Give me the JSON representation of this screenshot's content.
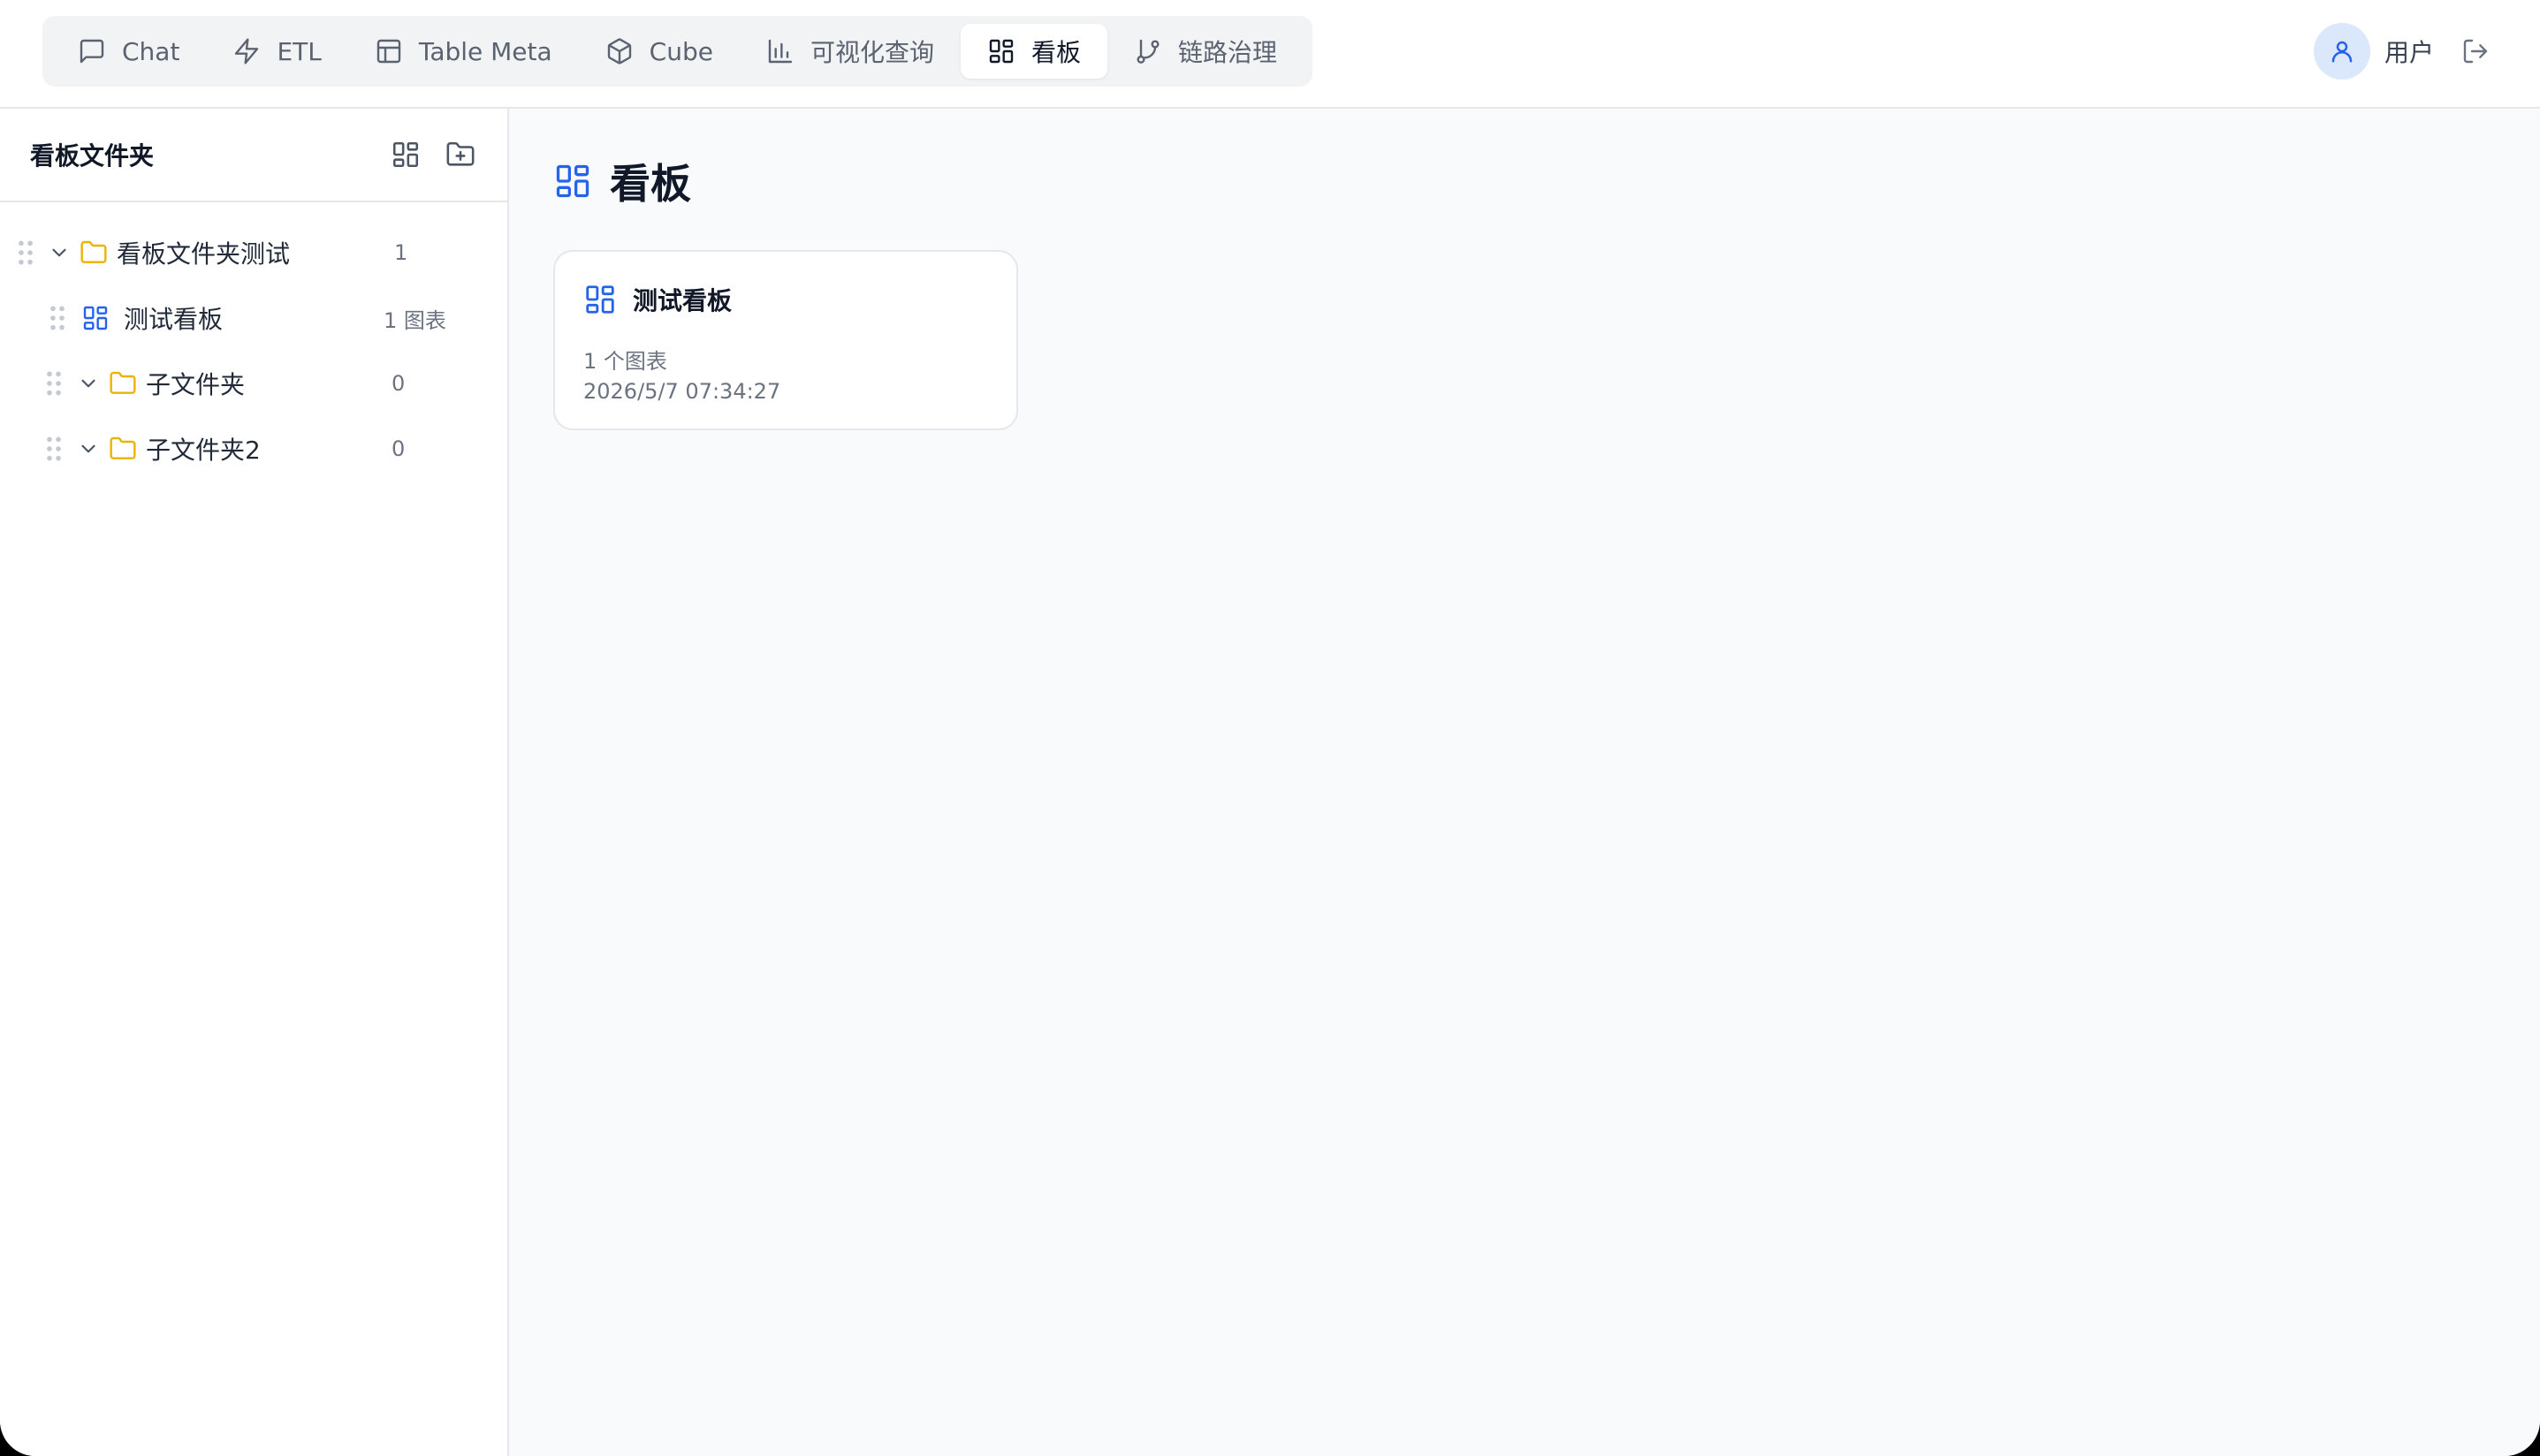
{
  "nav": {
    "tabs": [
      {
        "label": "Chat",
        "icon": "message-square-icon"
      },
      {
        "label": "ETL",
        "icon": "zap-icon"
      },
      {
        "label": "Table Meta",
        "icon": "table-icon"
      },
      {
        "label": "Cube",
        "icon": "cube-icon"
      },
      {
        "label": "可视化查询",
        "icon": "bar-chart-icon"
      },
      {
        "label": "看板",
        "icon": "dashboard-icon",
        "active": true
      },
      {
        "label": "链路治理",
        "icon": "git-branch-icon"
      }
    ]
  },
  "user": {
    "name": "用户"
  },
  "sidebar": {
    "title": "看板文件夹",
    "tree": [
      {
        "type": "folder",
        "label": "看板文件夹测试",
        "count": "1",
        "depth": 0
      },
      {
        "type": "dashboard",
        "label": "测试看板",
        "count": "1 图表",
        "depth": 1
      },
      {
        "type": "folder",
        "label": "子文件夹",
        "count": "0",
        "depth": 1
      },
      {
        "type": "folder",
        "label": "子文件夹2",
        "count": "0",
        "depth": 1
      }
    ]
  },
  "main": {
    "title": "看板",
    "cards": [
      {
        "title": "测试看板",
        "meta": "1 个图表",
        "date": "2026/5/7 07:34:27"
      }
    ]
  },
  "colors": {
    "accent": "#2563eb",
    "folder": "#eab308",
    "avatar_bg": "#dbe7fb",
    "main_bg": "#f8fafc"
  }
}
